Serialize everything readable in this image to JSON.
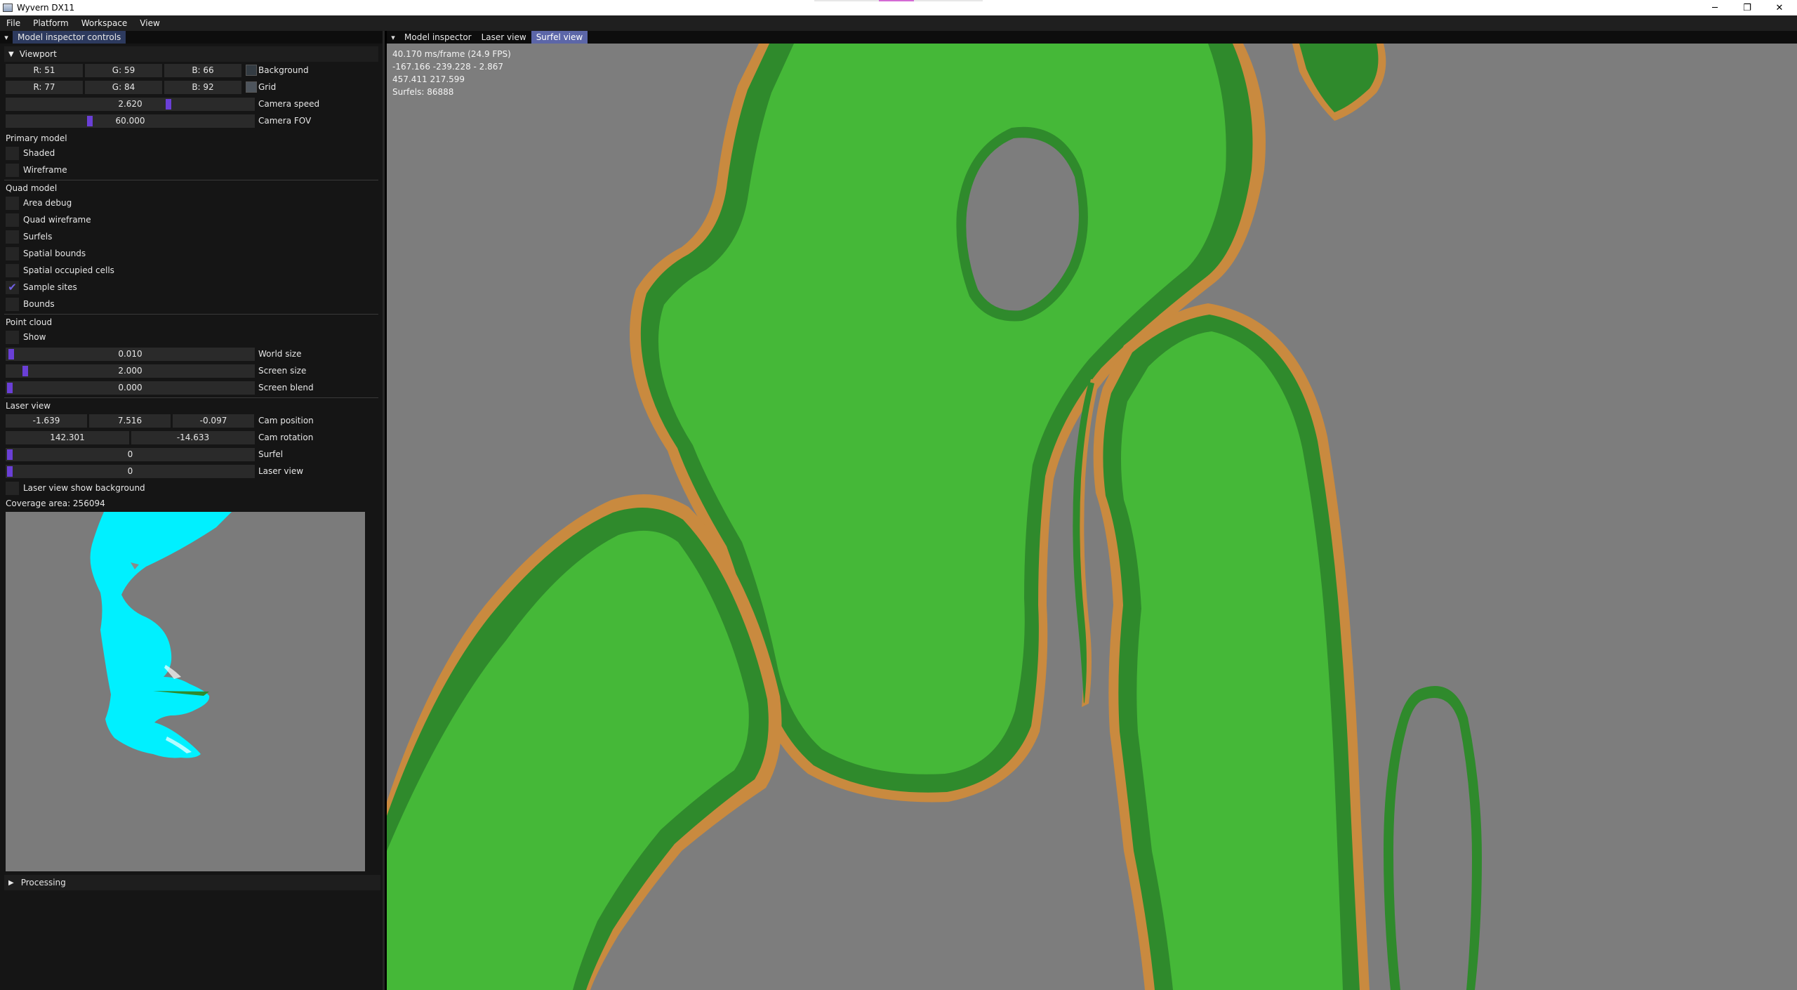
{
  "window": {
    "title": "Wyvern DX11",
    "minimize": "─",
    "restore": "❐",
    "close": "✕"
  },
  "menu": [
    "File",
    "Platform",
    "Workspace",
    "View"
  ],
  "left_panel": {
    "tab": "Model inspector controls",
    "viewport": {
      "header": "Viewport",
      "background": {
        "r": "R: 51",
        "g": "G: 59",
        "b": "B: 66",
        "label": "Background",
        "color": "#333b42"
      },
      "grid": {
        "r": "R: 77",
        "g": "G: 84",
        "b": "B: 92",
        "label": "Grid",
        "color": "#4d545c"
      },
      "camera_speed": {
        "value": "2.620",
        "label": "Camera speed",
        "fraction": 0.6
      },
      "camera_fov": {
        "value": "60.000",
        "label": "Camera FOV",
        "fraction": 0.33
      }
    },
    "primary_model": {
      "title": "Primary model",
      "items": [
        {
          "label": "Shaded",
          "checked": false
        },
        {
          "label": "Wireframe",
          "checked": false
        }
      ]
    },
    "quad_model": {
      "title": "Quad model",
      "items": [
        {
          "label": "Area debug",
          "checked": false
        },
        {
          "label": "Quad wireframe",
          "checked": false
        },
        {
          "label": "Surfels",
          "checked": false
        },
        {
          "label": "Spatial bounds",
          "checked": false
        },
        {
          "label": "Spatial occupied cells",
          "checked": false
        },
        {
          "label": "Sample sites",
          "checked": true
        },
        {
          "label": "Bounds",
          "checked": false
        }
      ]
    },
    "point_cloud": {
      "title": "Point cloud",
      "show": {
        "label": "Show",
        "checked": false
      },
      "world_size": {
        "value": "0.010",
        "label": "World size",
        "fraction": 0.0
      },
      "screen_size": {
        "value": "2.000",
        "label": "Screen size",
        "fraction": 0.06
      },
      "screen_blend": {
        "value": "0.000",
        "label": "Screen blend",
        "fraction": 0.0
      }
    },
    "laser_view": {
      "title": "Laser view",
      "cam_position": {
        "x": "-1.639",
        "y": "7.516",
        "z": "-0.097",
        "label": "Cam position"
      },
      "cam_rotation": {
        "x": "142.301",
        "y": "-14.633",
        "label": "Cam rotation"
      },
      "surfel": {
        "value": "0",
        "label": "Surfel",
        "fraction": 0.0
      },
      "laser_view": {
        "value": "0",
        "label": "Laser view",
        "fraction": 0.0
      },
      "show_background": {
        "label": "Laser view show background",
        "checked": false
      },
      "coverage": "Coverage area: 256094"
    },
    "processing": "Processing"
  },
  "right_panel": {
    "tabs": [
      "Model inspector",
      "Laser view",
      "Surfel view"
    ],
    "active_tab": "Surfel view",
    "overlay": {
      "fps": "40.170 ms/frame (24.9 FPS)",
      "position": "-167.166 -239.228 - 2.867",
      "rotation": "457.411 217.599",
      "surfels": "Surfels: 86888"
    }
  },
  "colors": {
    "accent": "#6a3fd6",
    "active_tab": "#5c66a8",
    "surfel_light": "#45b838",
    "surfel_dark": "#2f8a2c",
    "surfel_edge": "#c98a3f",
    "laser_cyan": "#00f0ff"
  }
}
